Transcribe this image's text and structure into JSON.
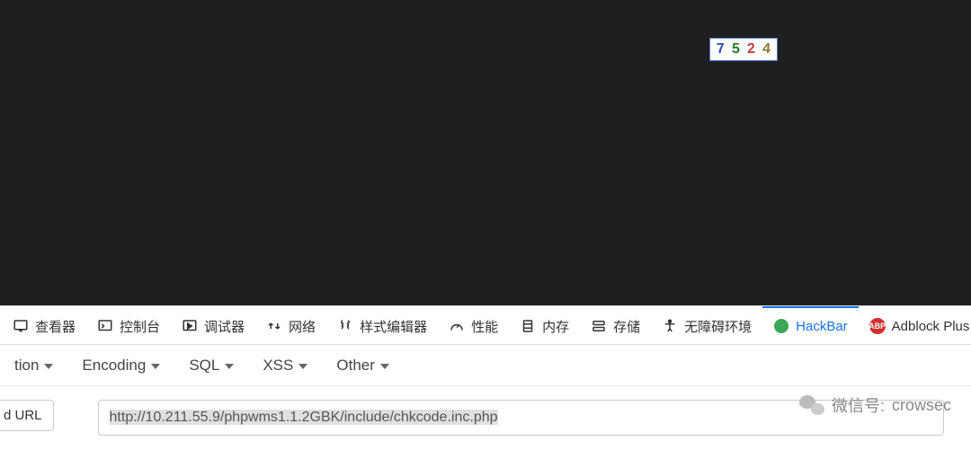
{
  "captcha": {
    "d1": "7",
    "d2": "5",
    "d3": "2",
    "d4": "4"
  },
  "devtools_tabs": {
    "inspector": "查看器",
    "console": "控制台",
    "debugger": "调试器",
    "network": "网络",
    "style": "样式编辑器",
    "performance": "性能",
    "memory": "内存",
    "storage": "存储",
    "accessibility": "无障碍环境",
    "hackbar": "HackBar",
    "adblock": "Adblock Plus",
    "abp_badge": "ABP"
  },
  "hackbar_menus": {
    "action": "tion",
    "encoding": "Encoding",
    "sql": "SQL",
    "xss": "XSS",
    "other": "Other"
  },
  "controls": {
    "load_url_label": "d URL",
    "url_value": "http://10.211.55.9/phpwms1.1.2GBK/include/chkcode.inc.php"
  },
  "watermark": {
    "label": "微信号:",
    "value": "crowsec"
  }
}
